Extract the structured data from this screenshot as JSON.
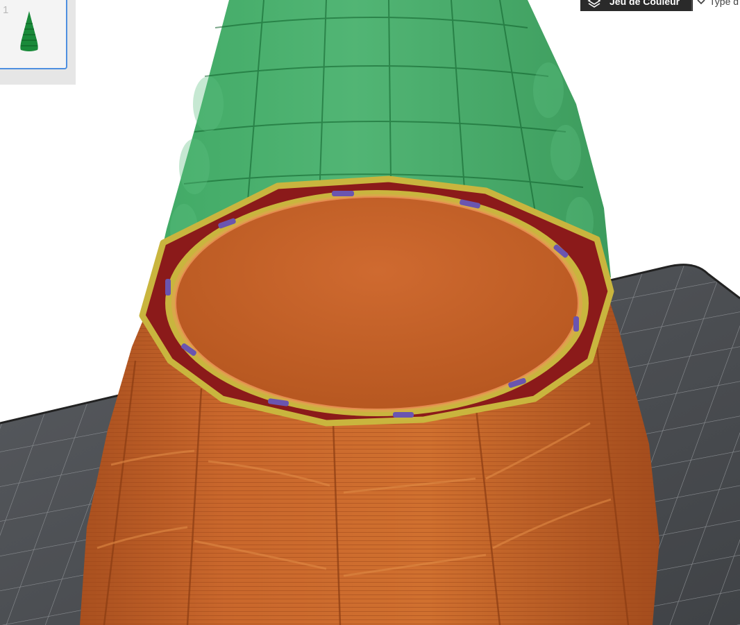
{
  "objects_panel": {
    "thumbnail_index": "1",
    "thumbnail_icon": "cone-model-icon"
  },
  "legend": {
    "title": "Jeu de Couleur",
    "title_icon": "layers-icon",
    "dropdown_icon": "chevron-down-icon",
    "dropdown_value": "Type d"
  },
  "colors": {
    "model_preview": "#1f9a4a",
    "printed_wall": "#c4622a",
    "infill_yellow": "#c9b53e",
    "infill_dark_red": "#8b1a1a",
    "travel_purple": "#6a55b0",
    "build_plate": "#3c3f43",
    "selection_border": "#4d8fe0"
  }
}
